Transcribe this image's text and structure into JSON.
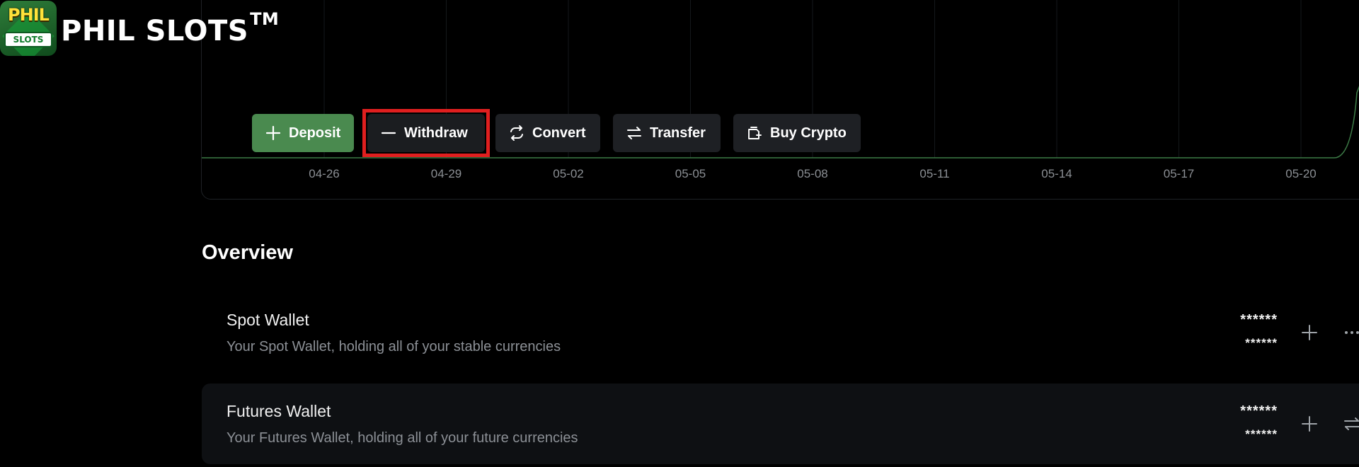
{
  "brand": {
    "logo_top": "PHIL",
    "logo_bottom": "SLOTS",
    "name": "PHIL SLOTS",
    "trademark": "TM"
  },
  "chart_data": {
    "type": "line",
    "x": [
      "04-26",
      "04-29",
      "05-02",
      "05-05",
      "05-08",
      "05-11",
      "05-14",
      "05-17",
      "05-20"
    ],
    "tick_labels": [
      "04-26",
      "04-29",
      "05-02",
      "05-05",
      "05-08",
      "05-11",
      "05-14",
      "05-17",
      "05-20"
    ],
    "series": [
      {
        "values": [
          0,
          0,
          0,
          0,
          0,
          0,
          0,
          0,
          0
        ]
      }
    ],
    "line_color": "#3c7a46",
    "grid": true
  },
  "actions": {
    "deposit": "Deposit",
    "withdraw": "Withdraw",
    "convert": "Convert",
    "transfer": "Transfer",
    "buy_crypto": "Buy Crypto"
  },
  "overview": {
    "title": "Overview",
    "wallets": [
      {
        "name": "Spot Wallet",
        "description": "Your Spot Wallet, holding all of your stable currencies",
        "balance_primary": "******",
        "balance_secondary": "******",
        "icons": [
          "plus-icon",
          "more-icon"
        ]
      },
      {
        "name": "Futures Wallet",
        "description": "Your Futures Wallet, holding all of your future currencies",
        "balance_primary": "******",
        "balance_secondary": "******",
        "icons": [
          "plus-icon",
          "transfer-icon"
        ]
      }
    ]
  },
  "colors": {
    "accent_green": "#4a8a4f",
    "highlight_red": "#e01f1f",
    "button_bg": "#1e2024"
  }
}
